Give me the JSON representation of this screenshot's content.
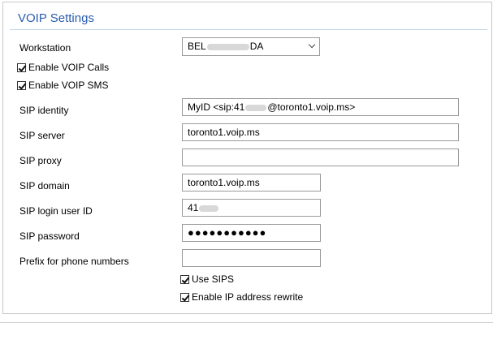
{
  "header": {
    "title": "VOIP Settings"
  },
  "workstation": {
    "label": "Workstation",
    "value_start": "BEL",
    "value_end": "DA"
  },
  "checkboxes": {
    "enable_voip_calls": {
      "label": "Enable VOIP Calls",
      "checked": true
    },
    "enable_voip_sms": {
      "label": "Enable VOIP SMS",
      "checked": true
    },
    "use_sips": {
      "label": "Use SIPS",
      "checked": true
    },
    "ip_rewrite": {
      "label": "Enable IP address rewrite",
      "checked": true
    }
  },
  "fields": {
    "sip_identity": {
      "label": "SIP identity",
      "value_start": "MyID <sip:41",
      "value_end": "@toronto1.voip.ms>"
    },
    "sip_server": {
      "label": "SIP server",
      "value": "toronto1.voip.ms"
    },
    "sip_proxy": {
      "label": "SIP proxy",
      "value": ""
    },
    "sip_domain": {
      "label": "SIP domain",
      "value": "toronto1.voip.ms"
    },
    "sip_login": {
      "label": "SIP login user ID",
      "value_start": "41"
    },
    "sip_password": {
      "label": "SIP password",
      "value": "●●●●●●●●●●●"
    },
    "prefix": {
      "label": "Prefix for phone numbers",
      "value": ""
    }
  },
  "icons": {
    "dropdown": "chevron-down-icon",
    "check": "check-icon"
  }
}
